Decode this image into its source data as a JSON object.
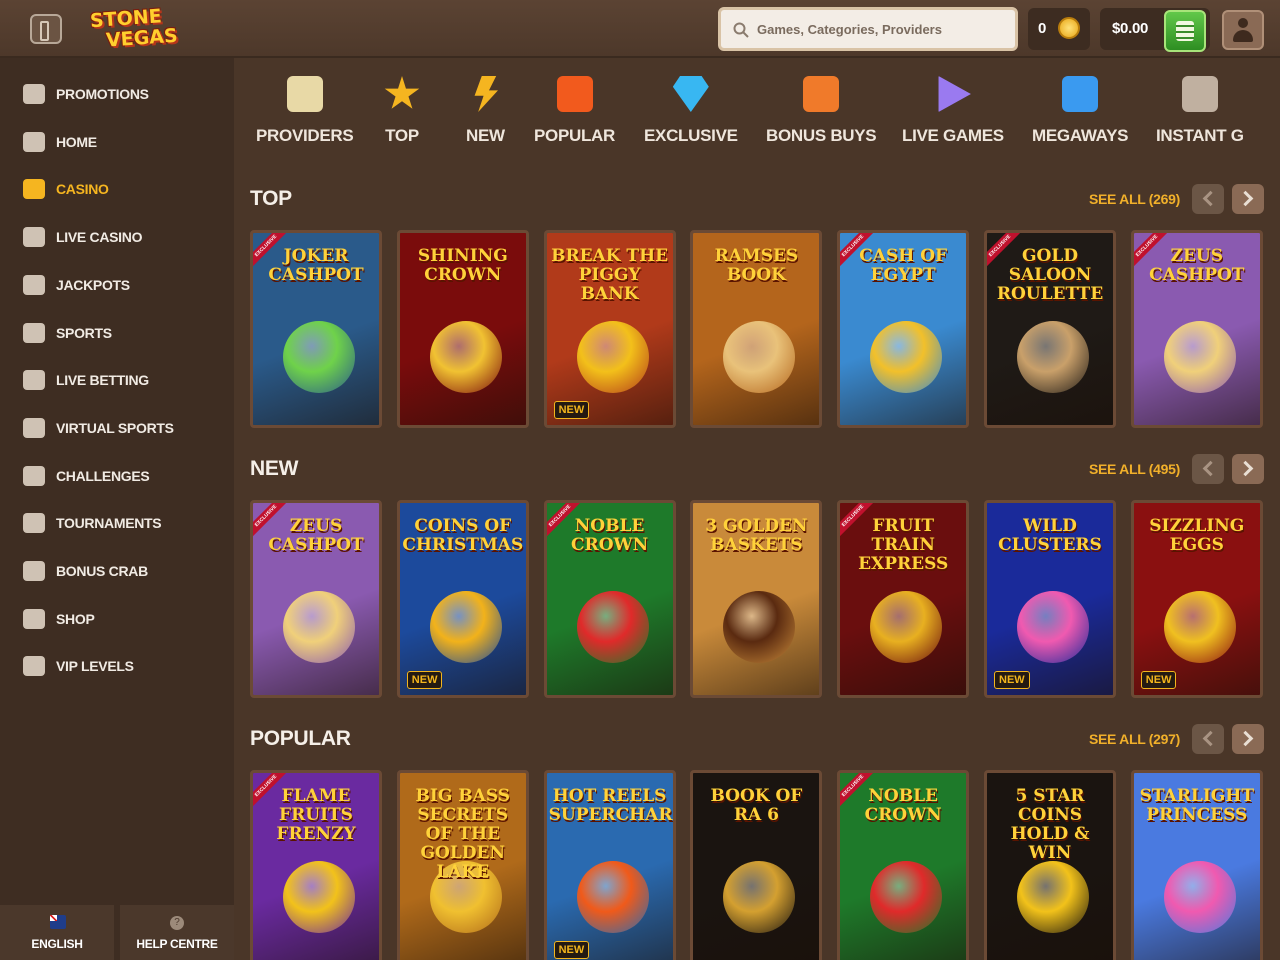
{
  "header": {
    "logo": {
      "line1": "STONE",
      "line2": "VEGAS"
    },
    "search": {
      "placeholder": "Games, Categories, Providers"
    },
    "coins": "0",
    "balance": "$0.00"
  },
  "sidebar": {
    "items": [
      {
        "label": "PROMOTIONS",
        "icon": "gift-icon"
      },
      {
        "label": "HOME",
        "icon": "home-icon"
      },
      {
        "label": "CASINO",
        "icon": "slot-machine-icon",
        "active": true
      },
      {
        "label": "LIVE CASINO",
        "icon": "chip-icon"
      },
      {
        "label": "JACKPOTS",
        "icon": "clover-icon"
      },
      {
        "label": "SPORTS",
        "icon": "football-icon"
      },
      {
        "label": "LIVE BETTING",
        "icon": "live-betting-icon"
      },
      {
        "label": "VIRTUAL SPORTS",
        "icon": "monitor-icon"
      },
      {
        "label": "CHALLENGES",
        "icon": "target-icon"
      },
      {
        "label": "TOURNAMENTS",
        "icon": "trophy-icon"
      },
      {
        "label": "BONUS CRAB",
        "icon": "crab-icon"
      },
      {
        "label": "SHOP",
        "icon": "basket-icon"
      },
      {
        "label": "VIP LEVELS",
        "icon": "crown-icon"
      }
    ],
    "footer": {
      "language": "ENGLISH",
      "help": "HELP CENTRE"
    }
  },
  "categories": [
    {
      "label": "PROVIDERS",
      "icon": "scroll-icon",
      "color": "#e8d9a6"
    },
    {
      "label": "TOP",
      "icon": "star-icon",
      "color": "#f5b520"
    },
    {
      "label": "NEW",
      "icon": "lightning-icon",
      "color": "#f5b520"
    },
    {
      "label": "POPULAR",
      "icon": "fire-icon",
      "color": "#f25a1d"
    },
    {
      "label": "EXCLUSIVE",
      "icon": "diamond-icon",
      "color": "#38b7f2"
    },
    {
      "label": "BONUS BUYS",
      "icon": "gift-box-icon",
      "color": "#f07a2a"
    },
    {
      "label": "LIVE GAMES",
      "icon": "play-icon",
      "color": "#9a7af0"
    },
    {
      "label": "MEGAWAYS",
      "icon": "megaways-icon",
      "color": "#3a9af0"
    },
    {
      "label": "INSTANT G",
      "icon": "joystick-icon",
      "color": "#c0b0a0"
    }
  ],
  "sections": [
    {
      "title": "TOP",
      "see_all": "SEE ALL (269)",
      "games": [
        {
          "title": "JOKER CASHPOT",
          "bg": "#2a5a8a",
          "accent": "#6fd24a",
          "exclusive": true
        },
        {
          "title": "SHINING CROWN",
          "bg": "#7a0c0c",
          "accent": "#f1c232"
        },
        {
          "title": "BREAK the PIGGY BANK",
          "bg": "#b13a1a",
          "accent": "#f3c01a",
          "new": true
        },
        {
          "title": "RAMSES BOOK",
          "bg": "#b4651c",
          "accent": "#e9c27a"
        },
        {
          "title": "CASH of EGYPT",
          "bg": "#3a8ad0",
          "accent": "#f2c02a",
          "exclusive": true
        },
        {
          "title": "GOLD SALOON ROULETTE",
          "bg": "#1f1a16",
          "accent": "#c9a06a",
          "exclusive": true
        },
        {
          "title": "ZEUS CASHPOT",
          "bg": "#8a5ab0",
          "accent": "#f0d07a",
          "exclusive": true
        }
      ]
    },
    {
      "title": "NEW",
      "see_all": "SEE ALL (495)",
      "games": [
        {
          "title": "ZEUS CASHPOT",
          "bg": "#8a5ab0",
          "accent": "#f0d07a",
          "exclusive": true
        },
        {
          "title": "COINS of Christmas",
          "bg": "#1c4a9c",
          "accent": "#f2b21a",
          "new": true
        },
        {
          "title": "NOBLE CROWN",
          "bg": "#1e7a2a",
          "accent": "#e02a2a",
          "exclusive": true
        },
        {
          "title": "3 GOLDEN BASKETS",
          "bg": "#c98a3a",
          "accent": "#5a2a10"
        },
        {
          "title": "FRUIT TRAIN EXPRESS",
          "bg": "#6a0e0e",
          "accent": "#e8b020",
          "exclusive": true
        },
        {
          "title": "WILD CLUSTERS",
          "bg": "#1a2a9a",
          "accent": "#f05ab0",
          "new": true
        },
        {
          "title": "SIZZLING EGGS",
          "bg": "#8a1010",
          "accent": "#f0c020",
          "new": true
        }
      ]
    },
    {
      "title": "POPULAR",
      "see_all": "SEE ALL (297)",
      "games": [
        {
          "title": "Flame Fruits FRENZY",
          "bg": "#6a2aa0",
          "accent": "#f2c21a",
          "exclusive": true
        },
        {
          "title": "BIG BASS Secrets of The Golden Lake",
          "bg": "#b06a1a",
          "accent": "#f0c030"
        },
        {
          "title": "HOT REELS SUPERCHARGED",
          "bg": "#2a6ab0",
          "accent": "#f05a1a",
          "new": true
        },
        {
          "title": "BOOK OF RA 6",
          "bg": "#1a1410",
          "accent": "#d4a030"
        },
        {
          "title": "NOBLE CROWN",
          "bg": "#1e7a2a",
          "accent": "#e02a2a",
          "exclusive": true
        },
        {
          "title": "5 STAR COINS HOLD & WIN",
          "bg": "#1a1410",
          "accent": "#f2c21a"
        },
        {
          "title": "Starlight Princess",
          "bg": "#4a7ae0",
          "accent": "#f05ab0"
        }
      ]
    }
  ],
  "labels": {
    "new_badge": "NEW",
    "exclusive_ribbon": "EXCLUSIVE"
  }
}
